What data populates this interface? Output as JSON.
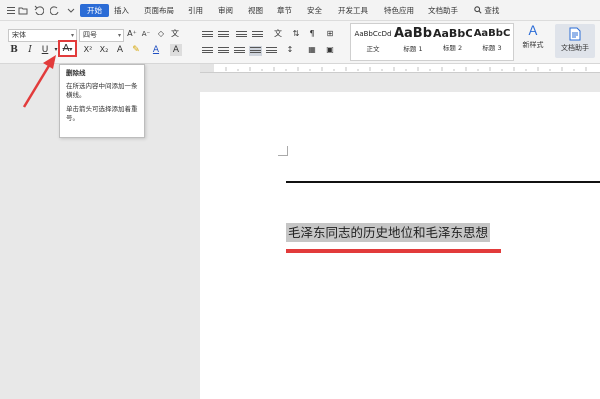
{
  "menu": {
    "tabs": [
      "开始",
      "插入",
      "页面布局",
      "引用",
      "审阅",
      "视图",
      "章节",
      "安全",
      "开发工具",
      "特色应用",
      "文档助手"
    ],
    "search_label": "查找"
  },
  "ribbon": {
    "font_name": "宋体",
    "font_size": "四号",
    "bold": "B",
    "italic": "I",
    "underline": "U",
    "strike_glyph": "A",
    "styles": [
      {
        "sample": "AaBbCcDd",
        "caption": "正文"
      },
      {
        "sample": "AaBb",
        "caption": "标题 1"
      },
      {
        "sample": "AaBbC",
        "caption": "标题 2"
      },
      {
        "sample": "AaBbC",
        "caption": "标题 3"
      }
    ],
    "new_style": "新样式",
    "doc_helper": "文档助手"
  },
  "tooltip": {
    "title": "删除线",
    "line1": "在所选内容中间添加一条横线。",
    "line2": "单击箭头可选择添加着重号。"
  },
  "document": {
    "text": "毛泽东同志的历史地位和毛泽东思想"
  },
  "colors": {
    "accent": "#2b6cd6",
    "highlight_red": "#e23b3b",
    "selection": "#c6c6c6"
  }
}
